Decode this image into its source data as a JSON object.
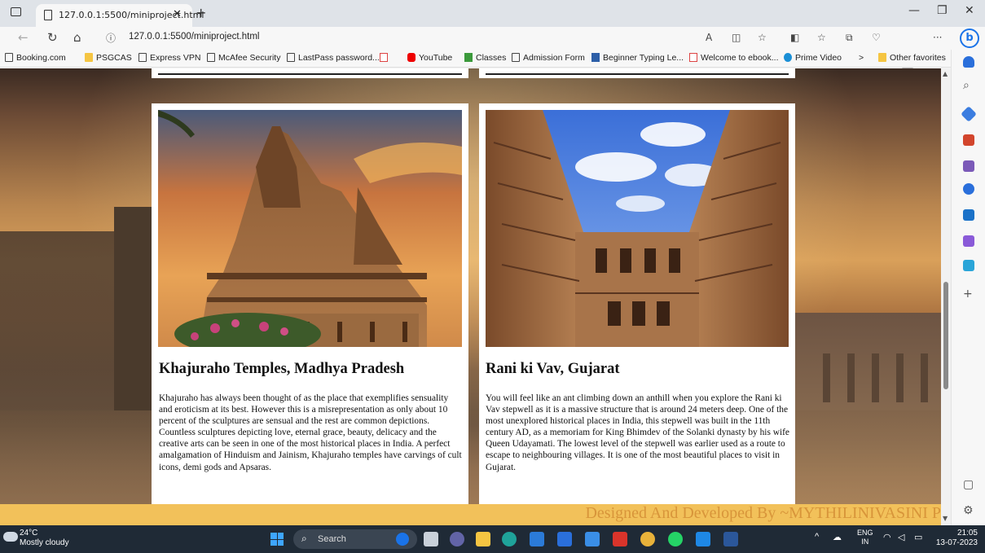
{
  "browser": {
    "tab_title": "127.0.0.1:5500/miniproject.html",
    "url": "127.0.0.1:5500/miniproject.html",
    "new_tab_label": "+",
    "favorites": [
      {
        "label": "Booking.com",
        "icon": "page-icon"
      },
      {
        "label": "PSGCAS",
        "icon": "folder-icon"
      },
      {
        "label": "Express VPN",
        "icon": "page-icon"
      },
      {
        "label": "McAfee Security",
        "icon": "page-icon"
      },
      {
        "label": "LastPass password...",
        "icon": "page-icon"
      },
      {
        "label": "",
        "icon": "gmail-icon"
      },
      {
        "label": "YouTube",
        "icon": "youtube-icon"
      },
      {
        "label": "Classes",
        "icon": "classroom-icon"
      },
      {
        "label": "Admission Form",
        "icon": "page-icon"
      },
      {
        "label": "Beginner Typing Le...",
        "icon": "typing-icon"
      },
      {
        "label": "Welcome to ebook...",
        "icon": "gmail-icon"
      },
      {
        "label": "Prime Video",
        "icon": "prime-icon"
      }
    ],
    "more_favorites": ">",
    "other_favorites": "Other favorites"
  },
  "cards": [
    {
      "title": "Khajuraho Temples, Madhya Pradesh",
      "text": "Khajuraho has always been thought of as the place that exemplifies sensuality and eroticism at its best. However this is a misrepresentation as only about 10 percent of the sculptures are sensual and the rest are common depictions. Countless sculptures depicting love, eternal grace, beauty, delicacy and the creative arts can be seen in one of the most historical places in India. A perfect amalgamation of Hinduism and Jainism, Khajuraho temples have carvings of cult icons, demi gods and Apsaras."
    },
    {
      "title": "Rani ki Vav, Gujarat",
      "text": "You will feel like an ant climbing down an anthill when you explore the Rani ki Vav stepwell as it is a massive structure that is around 24 meters deep. One of the most unexplored historical places in India, this stepwell was built in the 11th century AD, as a memoriam for King Bhimdev of the Solanki dynasty by his wife Queen Udayamati. The lowest level of the stepwell was earlier used as a route to escape to neighbouring villages. It is one of the most beautiful places to visit in Gujarat."
    }
  ],
  "footer": {
    "text": "Designed And Developed By ~MYTHILINIVASINI P"
  },
  "taskbar": {
    "temperature": "24°C",
    "weather": "Mostly cloudy",
    "search_label": "Search",
    "language": "ENG",
    "region": "IN",
    "time": "21:05",
    "date": "13-07-2023"
  },
  "colors": {
    "footer_bg": "#f2c15a",
    "footer_text": "#d8953a",
    "taskbar_bg": "#1f2a36",
    "accent": "#1a73e8"
  }
}
